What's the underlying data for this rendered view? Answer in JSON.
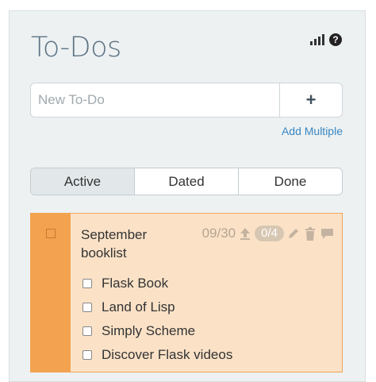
{
  "header": {
    "title": "To-Dos"
  },
  "icons": {
    "stats": "bar-chart-icon",
    "help": "help-icon",
    "help_glyph": "?"
  },
  "new_todo": {
    "placeholder": "New To-Do",
    "add_label": "+",
    "add_multiple": "Add Multiple"
  },
  "tabs": [
    {
      "label": "Active",
      "selected": true
    },
    {
      "label": "Dated",
      "selected": false
    },
    {
      "label": "Done",
      "selected": false
    }
  ],
  "todo": {
    "title": "September booklist",
    "date": "09/30",
    "progress": "0/4",
    "accent_color": "#f3a24f",
    "items": [
      {
        "label": "Flask Book",
        "checked": false
      },
      {
        "label": "Land of Lisp",
        "checked": false
      },
      {
        "label": "Simply Scheme",
        "checked": false
      },
      {
        "label": "Discover Flask videos",
        "checked": false
      }
    ]
  }
}
